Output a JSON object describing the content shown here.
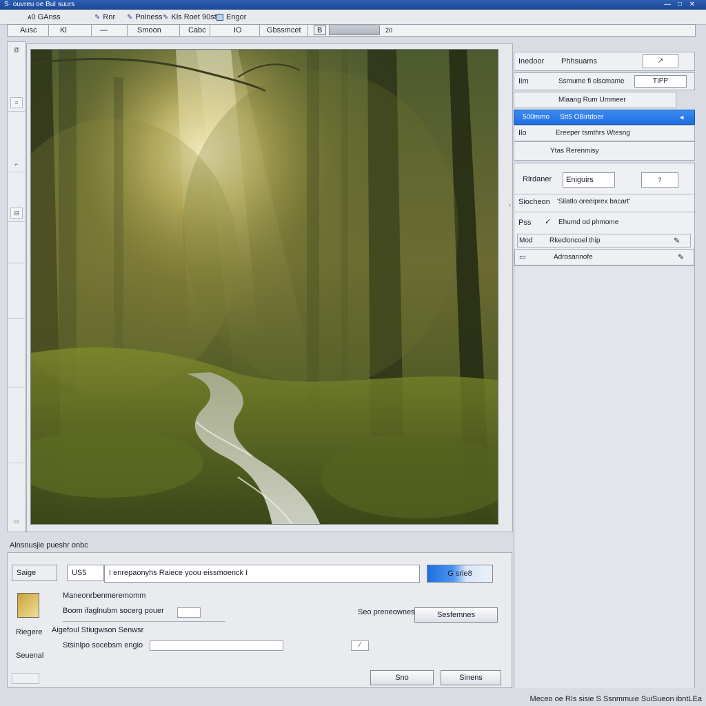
{
  "window": {
    "title": "S· ouvreu oe BuI suurs",
    "min_glyph": "—",
    "max_glyph": "□",
    "close_glyph": "✕"
  },
  "menubar": {
    "items": [
      {
        "label": "ᴀ0 GAnss"
      },
      {
        "label": "Rnr"
      },
      {
        "label": "Pnlness"
      },
      {
        "label": "Kls Roet 90st"
      },
      {
        "label": "Engor"
      }
    ]
  },
  "toolbar": {
    "cells": [
      "Ausc",
      "Kl",
      "—",
      "Smoon",
      "Cabc",
      "IO",
      "Gbssmcet",
      "B",
      "",
      "20"
    ]
  },
  "leftstrip": {
    "buttons": [
      "@",
      "=",
      "⌐",
      "⊟",
      "▭"
    ]
  },
  "right_panel": {
    "row1": {
      "label": "Inedoor",
      "sub": "Phhsuams",
      "box": "↗"
    },
    "row2": {
      "label": "Iim",
      "sub": "Ssmume fi olscmame",
      "box": "TIPP"
    },
    "row3": {
      "label": "Mlaang Rum Ummeer"
    },
    "row4_selected": {
      "label": "500mmo",
      "sub": "Stt5 OBirtdoer",
      "icon": "◂"
    },
    "row5": {
      "label": "Ilo",
      "sub": "Ereeper tsmthrs Wtesng"
    },
    "row6": {
      "label": "Ytas Rerenmisy"
    },
    "mid": {
      "r1_label": "Rlrdaner",
      "r1_value": "Eniguirs",
      "r1_box": "?",
      "r2_label": "Siocheon",
      "r2_text": "'Silatlo oreeiprex bacart'",
      "r3_label": "Pss",
      "r3_text": "Ehumd od phmome",
      "r4_label": "Mod",
      "r4_text": "Rkecloncoel thip",
      "r5_label": "Adrosannofe"
    }
  },
  "bottom": {
    "section_label": "Alnsnusjie pueshr onbc",
    "type_label": "Saige",
    "small_input": "US5",
    "prompt_value": "I enrepaonyhs Raiece yoou eissmoenck I",
    "go_button": "G srie8",
    "preview_title": "Maneonrbenmeremomm",
    "line1_label": "Boom ifaglnubm socerg pouer",
    "right_label": "Seo preneownes",
    "right_button": "Sesfemnes",
    "side_label1": "Riegere",
    "subtitle": "Aigefoul Stiugwson Senwsr",
    "line2_label": "Stsinlpo socebsm engio",
    "side_label2": "Seuenal",
    "primary_button": "Sno",
    "secondary_button": "Sinens"
  },
  "status": {
    "text": "Meceo oe RIs sisie S Ssnmmuie SuiSueon ibntLEa"
  }
}
